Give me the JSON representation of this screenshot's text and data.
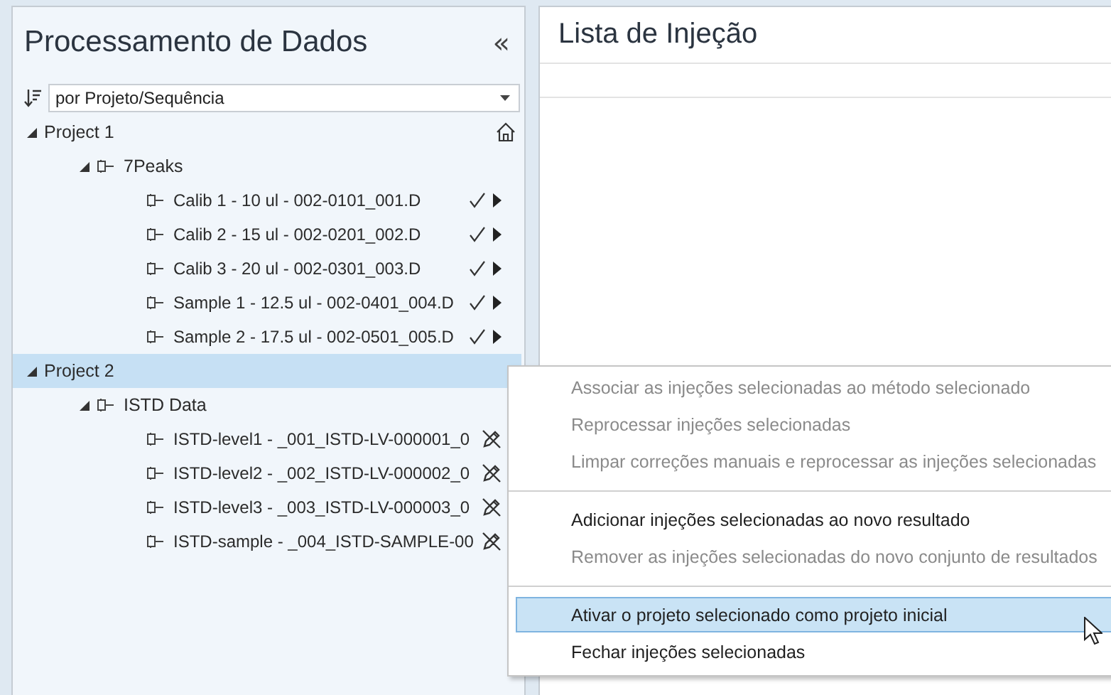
{
  "left_panel": {
    "title": "Processamento de Dados",
    "collapse_glyph": "«",
    "sort_dropdown": {
      "value": "por Projeto/Sequência"
    },
    "tree": [
      {
        "label": "Project 1",
        "expanded": true,
        "selected": false,
        "initial": true,
        "children": [
          {
            "label": "7Peaks",
            "expanded": true,
            "children": [
              {
                "label": "Calib 1 - 10 ul - 002-0101_001.D",
                "kind": "processed"
              },
              {
                "label": "Calib 2 - 15 ul - 002-0201_002.D",
                "kind": "processed"
              },
              {
                "label": "Calib 3 - 20 ul - 002-0301_003.D",
                "kind": "processed"
              },
              {
                "label": "Sample 1 - 12.5 ul - 002-0401_004.D",
                "kind": "processed"
              },
              {
                "label": "Sample 2 - 17.5 ul - 002-0501_005.D",
                "kind": "processed"
              }
            ]
          }
        ]
      },
      {
        "label": "Project 2",
        "expanded": true,
        "selected": true,
        "initial": false,
        "children": [
          {
            "label": "ISTD Data",
            "expanded": true,
            "children": [
              {
                "label": "ISTD-level1 - _001_ISTD-LV-000001_0",
                "kind": "excluded"
              },
              {
                "label": "ISTD-level2 - _002_ISTD-LV-000002_0",
                "kind": "excluded"
              },
              {
                "label": "ISTD-level3 - _003_ISTD-LV-000003_0",
                "kind": "excluded"
              },
              {
                "label": "ISTD-sample - _004_ISTD-SAMPLE-00",
                "kind": "excluded"
              }
            ]
          }
        ]
      }
    ]
  },
  "right_panel": {
    "title": "Lista de Injeção"
  },
  "context_menu": {
    "groups": [
      [
        {
          "label": "Associar as injeções selecionadas ao método selecionado",
          "disabled": true,
          "selected": false
        },
        {
          "label": "Reprocessar injeções selecionadas",
          "disabled": true,
          "selected": false
        },
        {
          "label": "Limpar correções manuais e reprocessar as injeções selecionadas",
          "disabled": true,
          "selected": false
        }
      ],
      [
        {
          "label": "Adicionar injeções selecionadas ao novo resultado",
          "disabled": false,
          "selected": false
        },
        {
          "label": "Remover as injeções selecionadas do novo conjunto de resultados",
          "disabled": true,
          "selected": false
        }
      ],
      [
        {
          "label": "Ativar o projeto selecionado como projeto inicial",
          "disabled": false,
          "selected": true
        },
        {
          "label": "Fechar injeções selecionadas",
          "disabled": false,
          "selected": false
        }
      ]
    ]
  }
}
